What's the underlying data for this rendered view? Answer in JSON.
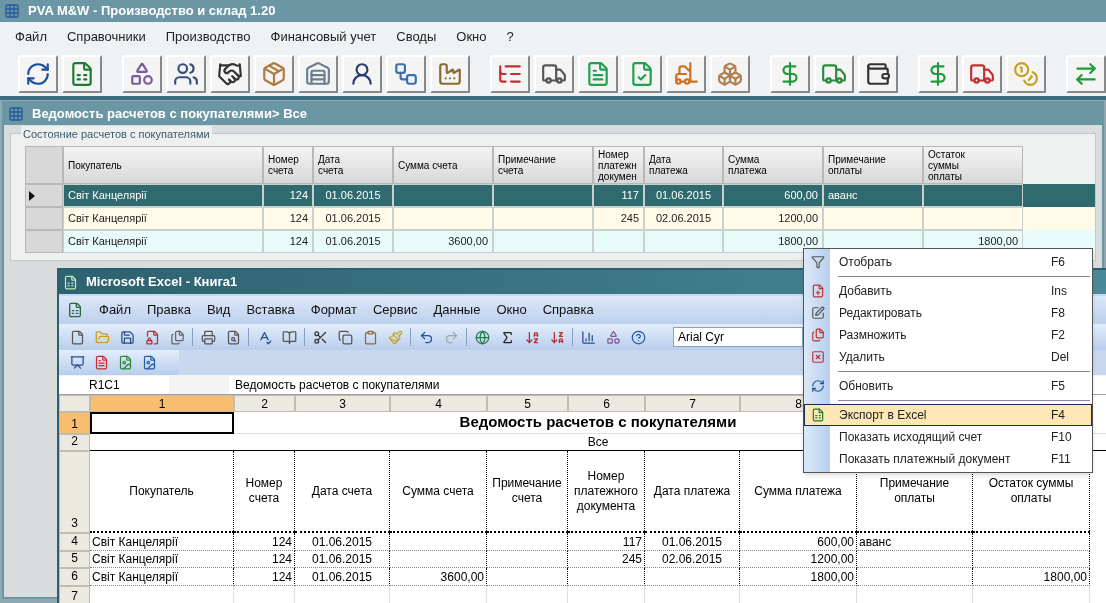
{
  "app": {
    "title": "PVA M&W - Производство и склад 1.20",
    "menu": [
      "Файл",
      "Справочники",
      "Производство",
      "Финансовый учет",
      "Своды",
      "Окно",
      "?"
    ]
  },
  "document": {
    "title": "Ведомость расчетов с покупателями> Все",
    "group_label": "Состояние расчетов с покупателями",
    "columns": [
      "Покупатель",
      "Номер\nсчета",
      "Дата\nсчета",
      "Сумма счета",
      "Примечание\nсчета",
      "Номер\nплатежн\nдокумен",
      "Дата\nплатежа",
      "Сумма\nплатежа",
      "Примечание\nоплаты",
      "Остаток\nсуммы\nоплаты"
    ],
    "rows": [
      {
        "selected": true,
        "cells": [
          "Світ Канцелярії",
          "124",
          "01.06.2015",
          "",
          "",
          "117",
          "01.06.2015",
          "600,00",
          "аванс",
          ""
        ]
      },
      {
        "selected": false,
        "cells": [
          "Світ Канцелярії",
          "124",
          "01.06.2015",
          "",
          "",
          "245",
          "02.06.2015",
          "1200,00",
          "",
          ""
        ]
      },
      {
        "selected": false,
        "cells": [
          "Світ Канцелярії",
          "124",
          "01.06.2015",
          "3600,00",
          "",
          "",
          "",
          "1800,00",
          "",
          "1800,00"
        ]
      }
    ]
  },
  "excel": {
    "title": "Microsoft Excel - Книга1",
    "menu": [
      "Файл",
      "Правка",
      "Вид",
      "Вставка",
      "Формат",
      "Сервис",
      "Данные",
      "Окно",
      "Справка"
    ],
    "font_name": "Arial Cyr",
    "name_box": "R1C1",
    "formula": "Ведомость расчетов с покупателями",
    "column_headers": [
      {
        "label": "1",
        "selected": true
      },
      {
        "label": "2",
        "selected": false
      },
      {
        "label": "3",
        "selected": false
      },
      {
        "label": "4",
        "selected": false
      },
      {
        "label": "5",
        "selected": false
      },
      {
        "label": "6",
        "selected": false
      },
      {
        "label": "7",
        "selected": false
      },
      {
        "label": "8",
        "selected": false
      }
    ],
    "row_numbers": [
      "1",
      "2",
      "3",
      "4",
      "5",
      "6",
      "7"
    ],
    "sheet_title": "Ведомость расчетов с покупателями",
    "sheet_subtitle": "Все",
    "headers": [
      "Покупатель",
      "Номер счета",
      "Дата счета",
      "Сумма счета",
      "Примечание счета",
      "Номер платежного документа",
      "Дата платежа",
      "Сумма платежа",
      "Примечание оплаты",
      "Остаток суммы оплаты"
    ],
    "rows": [
      [
        "Світ Канцелярії",
        "124",
        "01.06.2015",
        "",
        "",
        "117",
        "01.06.2015",
        "600,00",
        "аванс",
        ""
      ],
      [
        "Світ Канцелярії",
        "124",
        "01.06.2015",
        "",
        "",
        "245",
        "02.06.2015",
        "1200,00",
        "",
        ""
      ],
      [
        "Світ Канцелярії",
        "124",
        "01.06.2015",
        "3600,00",
        "",
        "",
        "",
        "1800,00",
        "",
        "1800,00"
      ]
    ]
  },
  "context_menu": {
    "items": [
      {
        "kind": "item",
        "label": "Отобрать",
        "shortcut": "F6",
        "selected": false
      },
      {
        "kind": "separator"
      },
      {
        "kind": "item",
        "label": "Добавить",
        "shortcut": "Ins",
        "selected": false
      },
      {
        "kind": "item",
        "label": "Редактировать",
        "shortcut": "F8",
        "selected": false
      },
      {
        "kind": "item",
        "label": "Размножить",
        "shortcut": "F2",
        "selected": false
      },
      {
        "kind": "item",
        "label": "Удалить",
        "shortcut": "Del",
        "selected": false
      },
      {
        "kind": "separator"
      },
      {
        "kind": "item",
        "label": "Обновить",
        "shortcut": "F5",
        "selected": false
      },
      {
        "kind": "separator"
      },
      {
        "kind": "item",
        "label": "Экспорт в Excel",
        "shortcut": "F4",
        "selected": true
      },
      {
        "kind": "item",
        "label": "Показать исходящий счет",
        "shortcut": "F10",
        "selected": false
      },
      {
        "kind": "item",
        "label": "Показать платежный документ",
        "shortcut": "F11",
        "selected": false
      }
    ]
  }
}
